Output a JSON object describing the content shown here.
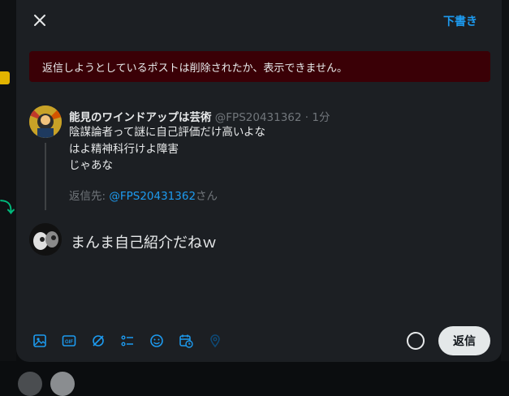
{
  "header": {
    "close_icon": "close-icon",
    "drafts_label": "下書き"
  },
  "error_banner": {
    "text": "返信しようとしているポストは削除されたか、表示できません。"
  },
  "original_post": {
    "name": "能見のワインドアップは芸術",
    "handle": "@FPS20431362",
    "time": "· 1分",
    "lines": [
      "陰謀論者って謎に自己評価だけ高いよな",
      "はよ精神科行けよ障害",
      "じゃあな"
    ],
    "reply_to_prefix": "返信先: ",
    "reply_to_handle": "@FPS20431362",
    "reply_to_suffix": "さん"
  },
  "composer": {
    "text": "まんま自己紹介だねｗ"
  },
  "toolbar": {
    "icons": [
      "image-icon",
      "gif-icon",
      "grok-icon",
      "poll-icon",
      "emoji-icon",
      "schedule-icon",
      "location-icon"
    ]
  },
  "actions": {
    "reply_label": "返信"
  },
  "colors": {
    "accent": "#1d9bf0",
    "banner_bg": "#3a0006",
    "modal_bg": "#1c1f23"
  }
}
